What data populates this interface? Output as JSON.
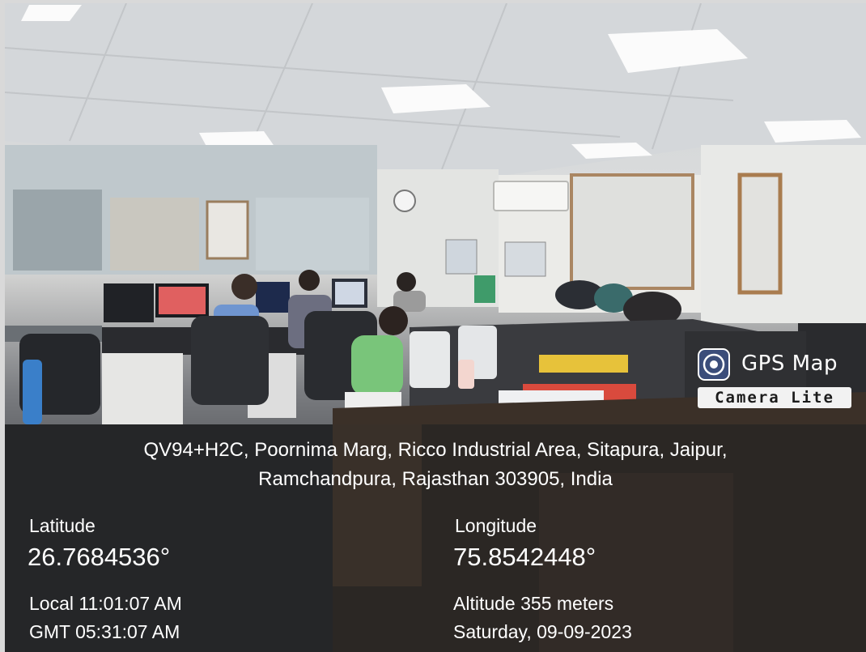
{
  "overlay": {
    "brand": {
      "title": "GPS Map",
      "subtitle": "Camera Lite",
      "logo_icon": "camera-lens-icon"
    },
    "address": {
      "line1": "QV94+H2C, Poornima Marg, Ricco Industrial Area, Sitapura, Jaipur,",
      "line2": "Ramchandpura, Rajasthan 303905, India"
    },
    "latitude": {
      "label": "Latitude",
      "value": "26.7684536°"
    },
    "longitude": {
      "label": "Longitude",
      "value": "75.8542448°"
    },
    "local_time": "Local 11:01:07 AM",
    "gmt_time": "GMT 05:31:07 AM",
    "altitude": "Altitude 355 meters",
    "date": "Saturday, 09-09-2023"
  },
  "colors": {
    "overlay_text": "#ffffff",
    "panel": "#202022",
    "badge_bg": "#f2f2f2"
  }
}
